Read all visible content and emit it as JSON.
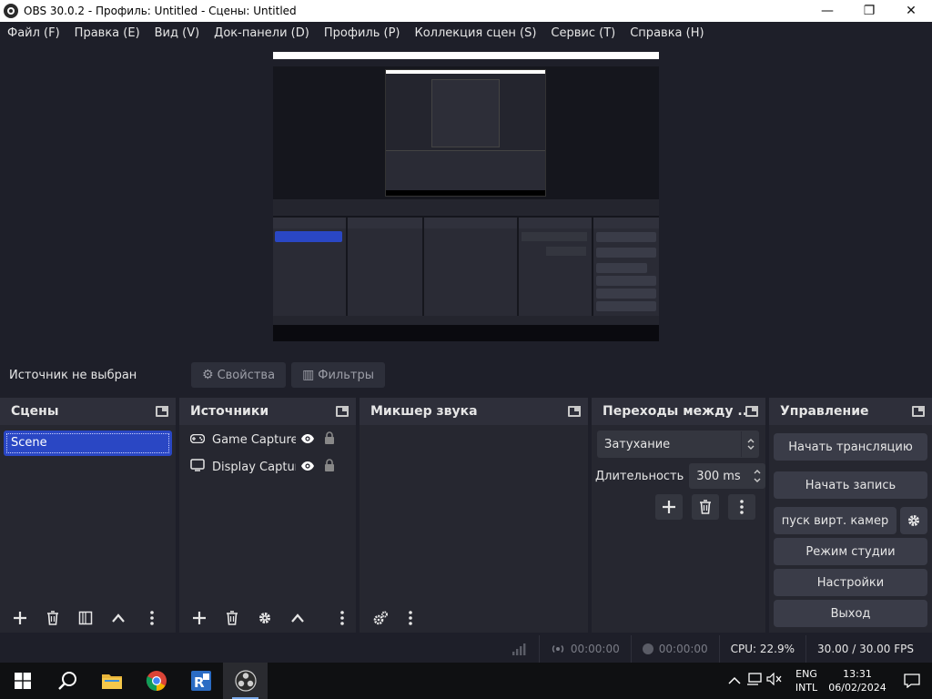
{
  "window": {
    "title": "OBS 30.0.2 - Профиль: Untitled - Сцены: Untitled",
    "minimize": "—",
    "maximize": "❐",
    "close": "✕"
  },
  "menu": [
    "Файл (F)",
    "Правка (E)",
    "Вид (V)",
    "Док-панели (D)",
    "Профиль (P)",
    "Коллекция сцен (S)",
    "Сервис (T)",
    "Справка (H)"
  ],
  "source_bar": {
    "no_source": "Источник не выбран",
    "properties": "Свойства",
    "filters": "Фильтры"
  },
  "docks": {
    "scenes": {
      "title": "Сцены",
      "items": [
        "Scene"
      ]
    },
    "sources": {
      "title": "Источники",
      "items": [
        {
          "name": "Game Capture",
          "icon": "gamepad-icon"
        },
        {
          "name": "Display Capture",
          "icon": "monitor-icon"
        }
      ]
    },
    "mixer": {
      "title": "Микшер звука"
    },
    "transitions": {
      "title": "Переходы между ...",
      "selected": "Затухание",
      "duration_label": "Длительность",
      "duration_value": "300 ms"
    },
    "controls": {
      "title": "Управление",
      "start_stream": "Начать трансляцию",
      "start_record": "Начать запись",
      "virtual_cam": "пуск вирт. камер",
      "studio_mode": "Режим студии",
      "settings": "Настройки",
      "exit": "Выход"
    }
  },
  "status": {
    "stream_time": "00:00:00",
    "record_time": "00:00:00",
    "cpu": "CPU: 22.9%",
    "fps": "30.00 / 30.00 FPS"
  },
  "taskbar": {
    "lang_top": "ENG",
    "lang_bottom": "INTL",
    "time": "13:31",
    "date": "06/02/2024"
  },
  "colors": {
    "background": "#1e1f29",
    "dock": "#262730",
    "selection": "#2a47c4",
    "button": "#3a3c48"
  }
}
